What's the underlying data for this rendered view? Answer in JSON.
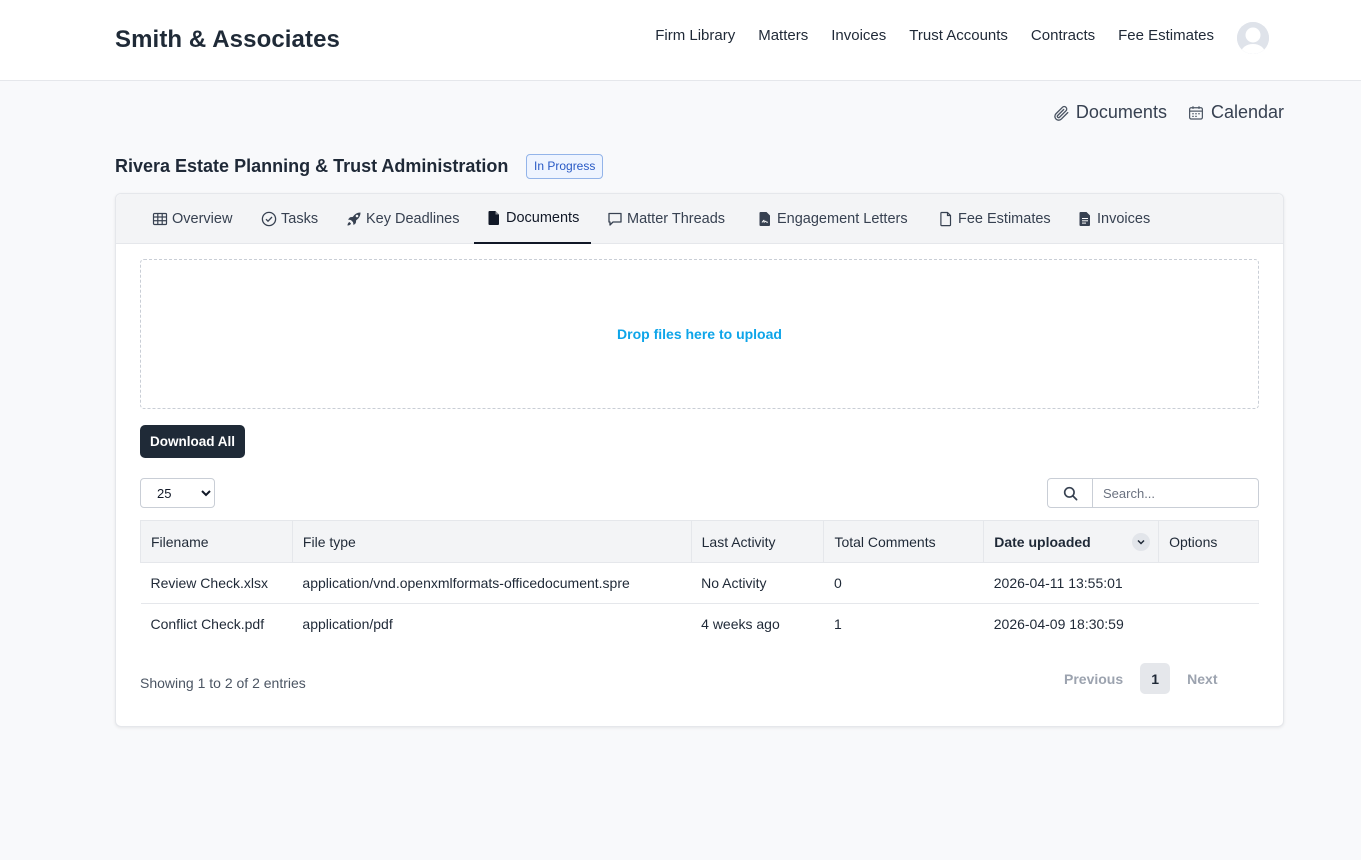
{
  "app": {
    "brand": "Smith & Associates"
  },
  "nav": [
    "Firm Library",
    "Matters",
    "Invoices",
    "Trust Accounts",
    "Contracts",
    "Fee Estimates"
  ],
  "quicklinks": {
    "documents": "Documents",
    "calendar": "Calendar"
  },
  "matter": {
    "title": "Rivera Estate Planning & Trust Administration",
    "status": "In Progress"
  },
  "tabs": [
    "Overview",
    "Tasks",
    "Key Deadlines",
    "Documents",
    "Matter Threads",
    "Engagement Letters",
    "Fee Estimates",
    "Invoices"
  ],
  "active_tab": "Documents",
  "dropzone": {
    "label": "Drop files here to upload"
  },
  "actions": {
    "download_all": "Download All"
  },
  "page_size": {
    "selected": "25"
  },
  "search": {
    "placeholder": "Search..."
  },
  "table": {
    "columns": [
      "Filename",
      "File type",
      "Last Activity",
      "Total Comments",
      "Date uploaded",
      "Options"
    ],
    "rows": [
      [
        "Review Check.xlsx",
        "application/vnd.openxmlformats-officedocument.spre",
        "No Activity",
        "0",
        "2026-04-11 13:55:01",
        ""
      ],
      [
        "Conflict Check.pdf",
        "application/pdf",
        "4 weeks ago",
        "1",
        "2026-04-09 18:30:59",
        ""
      ]
    ]
  },
  "footer": {
    "info": "Showing 1 to 2 of 2 entries",
    "previous": "Previous",
    "page": "1",
    "next": "Next"
  },
  "colors": {
    "accent": "#0ea5e9",
    "dark": "#1f2a37",
    "badge": "#2859c5"
  }
}
